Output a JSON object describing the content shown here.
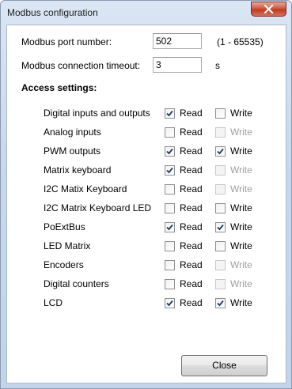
{
  "window": {
    "title": "Modbus configuration"
  },
  "port": {
    "label": "Modbus port number:",
    "value": "502",
    "range": "(1 - 65535)"
  },
  "timeout": {
    "label": "Modbus connection timeout:",
    "value": "3",
    "unit": "s"
  },
  "access": {
    "heading": "Access settings:",
    "read_label": "Read",
    "write_label": "Write",
    "rows": [
      {
        "name": "Digital inputs and outputs",
        "read": true,
        "write": false,
        "write_enabled": true
      },
      {
        "name": "Analog inputs",
        "read": false,
        "write": false,
        "write_enabled": false
      },
      {
        "name": "PWM outputs",
        "read": true,
        "write": true,
        "write_enabled": true
      },
      {
        "name": "Matrix keyboard",
        "read": true,
        "write": false,
        "write_enabled": false
      },
      {
        "name": "I2C Matix Keyboard",
        "read": false,
        "write": false,
        "write_enabled": false
      },
      {
        "name": "I2C Matrix Keyboard LED",
        "read": false,
        "write": false,
        "write_enabled": true
      },
      {
        "name": "PoExtBus",
        "read": true,
        "write": true,
        "write_enabled": true
      },
      {
        "name": "LED Matrix",
        "read": false,
        "write": false,
        "write_enabled": true
      },
      {
        "name": "Encoders",
        "read": false,
        "write": false,
        "write_enabled": false
      },
      {
        "name": "Digital counters",
        "read": false,
        "write": false,
        "write_enabled": false
      },
      {
        "name": "LCD",
        "read": true,
        "write": true,
        "write_enabled": true
      }
    ]
  },
  "buttons": {
    "close": "Close"
  }
}
